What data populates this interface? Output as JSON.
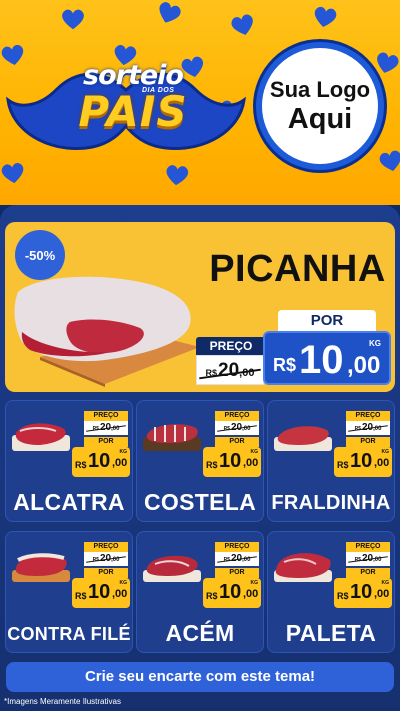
{
  "header": {
    "title_top": "sorteio",
    "title_sub": "DIA DOS",
    "title_main": "PAIS",
    "logo_line1": "Sua Logo",
    "logo_line2": "Aqui"
  },
  "featured": {
    "discount": "-50%",
    "name": "PICANHA",
    "preco_label": "PREÇO",
    "old_currency": "R$",
    "old_int": "20",
    "old_dec": ",00",
    "por_label": "POR",
    "new_currency": "R$",
    "new_int": "10",
    "new_dec": ",00",
    "unit": "KG"
  },
  "products": [
    {
      "name": "ALCATRA",
      "preco_label": "PREÇO",
      "old_currency": "R$",
      "old_int": "20",
      "old_dec": ",00",
      "por_label": "POR",
      "new_currency": "R$",
      "new_int": "10",
      "new_dec": ",00",
      "unit": "KG"
    },
    {
      "name": "COSTELA",
      "preco_label": "PREÇO",
      "old_currency": "R$",
      "old_int": "20",
      "old_dec": ",00",
      "por_label": "POR",
      "new_currency": "R$",
      "new_int": "10",
      "new_dec": ",00",
      "unit": "KG"
    },
    {
      "name": "FRALDINHA",
      "preco_label": "PREÇO",
      "old_currency": "R$",
      "old_int": "20",
      "old_dec": ",00",
      "por_label": "POR",
      "new_currency": "R$",
      "new_int": "10",
      "new_dec": ",00",
      "unit": "KG"
    },
    {
      "name": "CONTRA FILÉ",
      "preco_label": "PREÇO",
      "old_currency": "R$",
      "old_int": "20",
      "old_dec": ",00",
      "por_label": "POR",
      "new_currency": "R$",
      "new_int": "10",
      "new_dec": ",00",
      "unit": "KG"
    },
    {
      "name": "ACÉM",
      "preco_label": "PREÇO",
      "old_currency": "R$",
      "old_int": "20",
      "old_dec": ",00",
      "por_label": "POR",
      "new_currency": "R$",
      "new_int": "10",
      "new_dec": ",00",
      "unit": "KG"
    },
    {
      "name": "PALETA",
      "preco_label": "PREÇO",
      "old_currency": "R$",
      "old_int": "20",
      "old_dec": ",00",
      "por_label": "POR",
      "new_currency": "R$",
      "new_int": "10",
      "new_dec": ",00",
      "unit": "KG"
    }
  ],
  "cta": "Crie seu encarte com este tema!",
  "disclaimer": "*Imagens Meramente Ilustrativas",
  "colors": {
    "header_yellow": "#ffb300",
    "panel_blue": "#1d3d8e",
    "accent_blue": "#2f62d8",
    "price_yellow": "#ffc21a"
  }
}
